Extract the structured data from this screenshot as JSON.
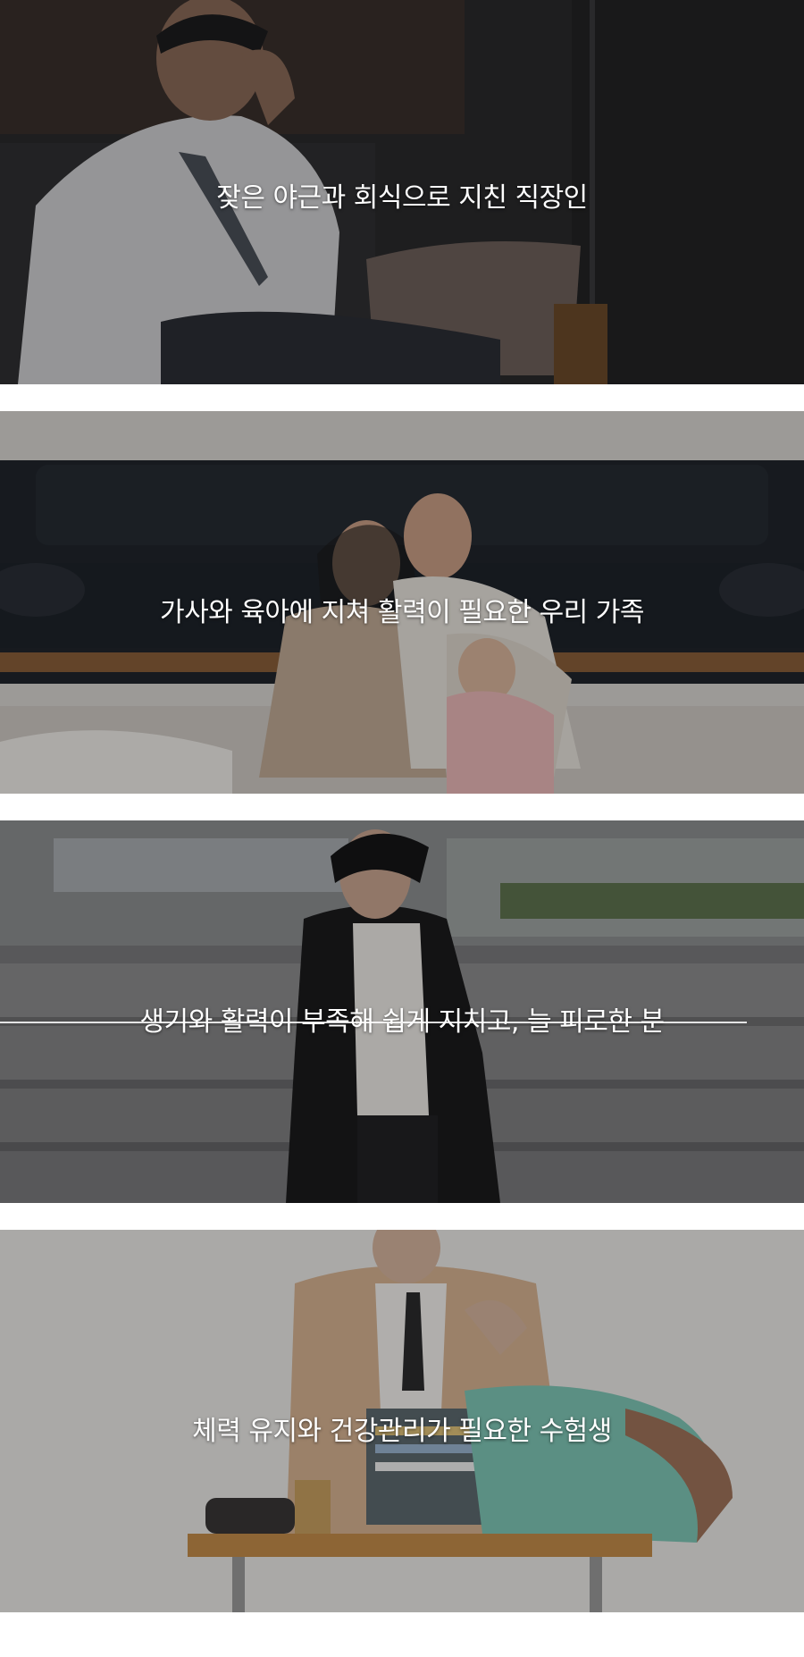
{
  "panels": [
    {
      "caption": "잦은 야근과 회식으로 지친 직장인",
      "photo": "tired-office-worker-on-sofa"
    },
    {
      "caption": "가사와 육아에 지쳐 활력이 필요한 우리 가족",
      "photo": "tired-family-on-floor-by-sofa"
    },
    {
      "caption": "생기와 활력이 부족해 쉽게 지치고, 늘 피로한 분",
      "photo": "tired-woman-in-blazer-on-steps"
    },
    {
      "caption": "체력 유지와 건강관리가 필요한 수험생",
      "photo": "tired-student-at-desk-with-backpack"
    }
  ]
}
